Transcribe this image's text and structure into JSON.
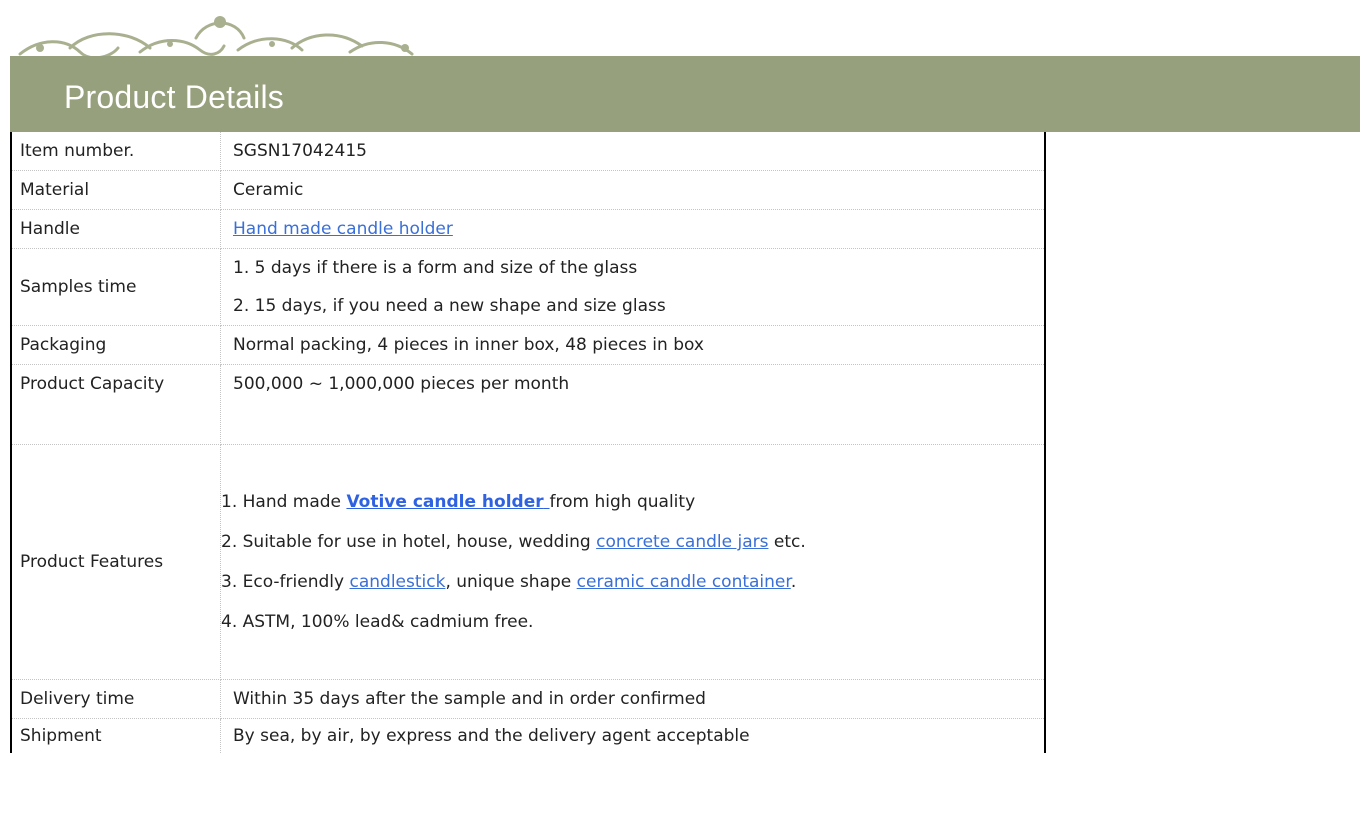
{
  "header": {
    "title": "Product Details"
  },
  "colors": {
    "banner": "#97a07d",
    "link": "#3a6fd8",
    "ornament": "#a0a888"
  },
  "rows": {
    "item_number": {
      "label": "Item number.",
      "value": "SGSN17042415"
    },
    "material": {
      "label": "Material",
      "value": "Ceramic"
    },
    "handle": {
      "label": "Handle",
      "link": "Hand made candle holder"
    },
    "samples_time": {
      "label": "Samples time",
      "lines": [
        "1. 5 days if there is a form and size of the glass",
        "2. 15 days, if you need a new shape and size glass"
      ]
    },
    "packaging": {
      "label": "Packaging",
      "value": "Normal packing, 4 pieces in inner box, 48 pieces in box"
    },
    "product_capacity": {
      "label": "Product Capacity",
      "value": "500,000 ~ 1,000,000 pieces per month"
    },
    "product_features": {
      "label": "Product Features",
      "f1_prefix": "1. Hand made ",
      "f1_link": "Votive candle holder",
      "f1_suffix": "from high quality",
      "f2_prefix": "2. Suitable for use in hotel, house, wedding ",
      "f2_link": "concrete candle jars",
      "f2_suffix": " etc.",
      "f3_prefix": "3. Eco-friendly ",
      "f3_link1": "candlestick",
      "f3_mid": ", unique shape ",
      "f3_link2": "ceramic candle container",
      "f3_suffix": ".",
      "f4": "4. ASTM, 100% lead& cadmium free."
    },
    "delivery_time": {
      "label": "Delivery time",
      "value": "Within 35 days after the sample and in order confirmed"
    },
    "shipment": {
      "label": "Shipment",
      "value": "By sea, by air, by express and the delivery agent acceptable"
    }
  }
}
